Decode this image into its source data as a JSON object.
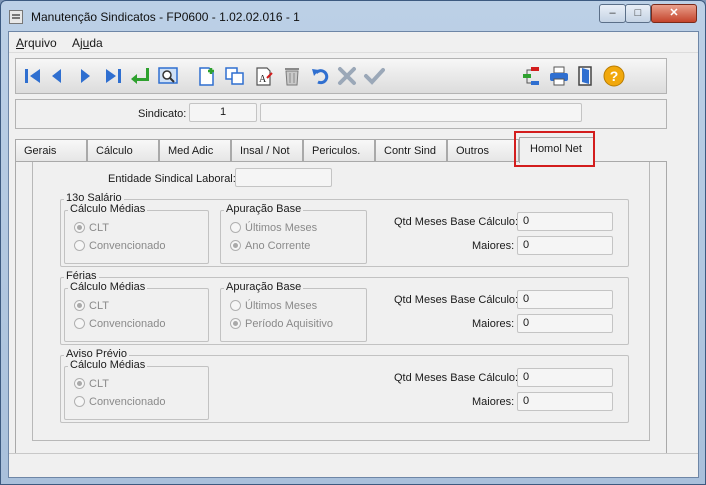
{
  "window": {
    "title": "Manutenção Sindicatos - FP0600 - 1.02.02.016 - 1",
    "minimize": "–",
    "maximize": "□",
    "close": "✕"
  },
  "menu": {
    "arquivo_u": "A",
    "arquivo_rest": "rquivo",
    "ajuda_pre": "Aj",
    "ajuda_u": "u",
    "ajuda_post": "da"
  },
  "toolbar": {
    "icons": [
      "first-record-icon",
      "previous-record-icon",
      "next-record-icon",
      "last-record-icon",
      "go-to-icon",
      "search-icon",
      "new-record-icon",
      "copy-record-icon",
      "edit-record-icon",
      "delete-icon",
      "undo-icon",
      "cancel-icon",
      "save-icon",
      "tree-view-icon",
      "print-icon",
      "exit-icon",
      "help-icon"
    ],
    "help_label": "?"
  },
  "header": {
    "sindicato_label": "Sindicato:",
    "sindicato_value": "1",
    "sindicato_desc": ""
  },
  "tabs": [
    "Gerais",
    "Cálculo",
    "Med Adic",
    "Insal / Not",
    "Periculos.",
    "Contr Sind",
    "Outros",
    "Homol Net"
  ],
  "active_tab": "Homol Net",
  "entidade": {
    "label": "Entidade Sindical Laboral:",
    "value": ""
  },
  "sections": [
    {
      "title": "13o Salário",
      "calculo": {
        "title": "Cálculo Médias",
        "options": [
          "CLT",
          "Convencionado"
        ],
        "selected": 0
      },
      "apuracao": {
        "title": "Apuração Base",
        "options": [
          "Últimos Meses",
          "Ano Corrente"
        ],
        "selected": 1
      },
      "qtd_label": "Qtd Meses Base Cálculo:",
      "qtd_value": "0",
      "maiores_label": "Maiores:",
      "maiores_value": "0"
    },
    {
      "title": "Férias",
      "calculo": {
        "title": "Cálculo Médias",
        "options": [
          "CLT",
          "Convencionado"
        ],
        "selected": 0
      },
      "apuracao": {
        "title": "Apuração Base",
        "options": [
          "Últimos Meses",
          "Período Aquisitivo"
        ],
        "selected": 1
      },
      "qtd_label": "Qtd Meses Base Cálculo:",
      "qtd_value": "0",
      "maiores_label": "Maiores:",
      "maiores_value": "0"
    },
    {
      "title": "Aviso Prévio",
      "calculo": {
        "title": "Cálculo Médias",
        "options": [
          "CLT",
          "Convencionado"
        ],
        "selected": 0
      },
      "qtd_label": "Qtd Meses Base Cálculo:",
      "qtd_value": "0",
      "maiores_label": "Maiores:",
      "maiores_value": "0"
    }
  ],
  "colors": {
    "accent_blue": "#2f6fd0",
    "highlight_red": "#d31d1d",
    "green_arrow": "#2ea12e"
  }
}
